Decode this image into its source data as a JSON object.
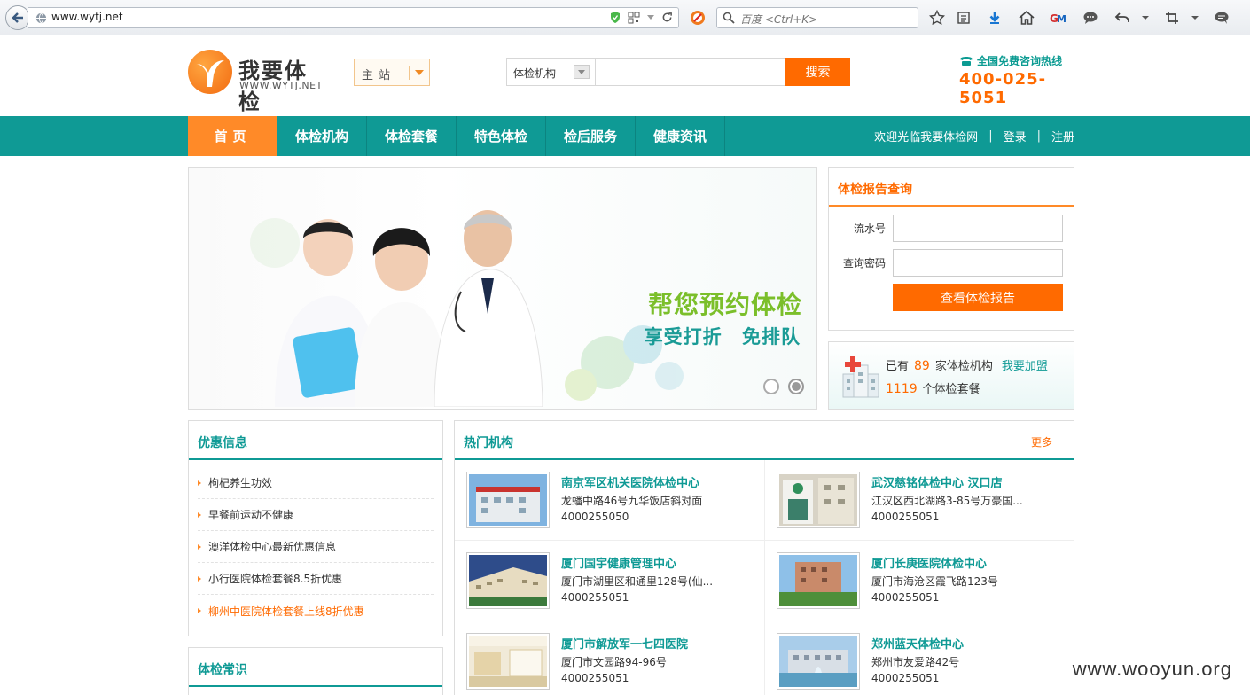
{
  "browser": {
    "url": "www.wytj.net",
    "search_placeholder": "百度 <Ctrl+K>"
  },
  "header": {
    "logo_title": "我要体检",
    "logo_sub": "WWW.WYTJ.NET",
    "site_select": "主站",
    "search_category": "体检机构",
    "search_input": "",
    "search_button": "搜索",
    "hotline_label": "全国免费咨询热线",
    "hotline_number": "400-025-5051"
  },
  "nav": {
    "items": [
      {
        "label": "首页"
      },
      {
        "label": "体检机构"
      },
      {
        "label": "体检套餐"
      },
      {
        "label": "特色体检"
      },
      {
        "label": "检后服务"
      },
      {
        "label": "健康资讯"
      }
    ],
    "welcome": "欢迎光临我要体检网",
    "login": "登录",
    "register": "注册",
    "separator": "|"
  },
  "banner": {
    "headline": "帮您预约体检",
    "subline": "享受打折  免排队"
  },
  "report": {
    "title": "体检报告查询",
    "serial_label": "流水号",
    "serial_value": "",
    "password_label": "查询密码",
    "password_value": "",
    "button": "查看体检报告"
  },
  "stats": {
    "prefix": "已有",
    "institutions": "89",
    "institutions_suffix": "家体检机构",
    "join": "我要加盟",
    "packages": "1119",
    "packages_suffix": "个体检套餐"
  },
  "promo": {
    "title": "优惠信息",
    "items": [
      "枸杞养生功效",
      "早餐前运动不健康",
      "澳洋体检中心最新优惠信息",
      "小行医院体检套餐8.5折优惠",
      "柳州中医院体检套餐上线8折优惠"
    ]
  },
  "knowledge": {
    "title": "体检常识"
  },
  "hot": {
    "title": "热门机构",
    "more": "更多",
    "items": [
      {
        "name": "南京军区机关医院体检中心",
        "address": "龙蟠中路46号九华饭店斜对面",
        "phone": "4000255050"
      },
      {
        "name": "武汉慈铭体检中心 汉口店",
        "address": "江汉区西北湖路3-85号万豪国...",
        "phone": "4000255051"
      },
      {
        "name": "厦门国宇健康管理中心",
        "address": "厦门市湖里区和通里128号(仙...",
        "phone": "4000255051"
      },
      {
        "name": "厦门长庚医院体检中心",
        "address": "厦门市海沧区霞飞路123号",
        "phone": "4000255051"
      },
      {
        "name": "厦门市解放军一七四医院",
        "address": "厦门市文园路94-96号",
        "phone": "4000255051"
      },
      {
        "name": "郑州蓝天体检中心",
        "address": "郑州市友爱路42号",
        "phone": "4000255051"
      }
    ]
  },
  "watermark": "www.wooyun.org",
  "colors": {
    "brand_teal": "#0f9a95",
    "brand_orange": "#ff6a00"
  }
}
